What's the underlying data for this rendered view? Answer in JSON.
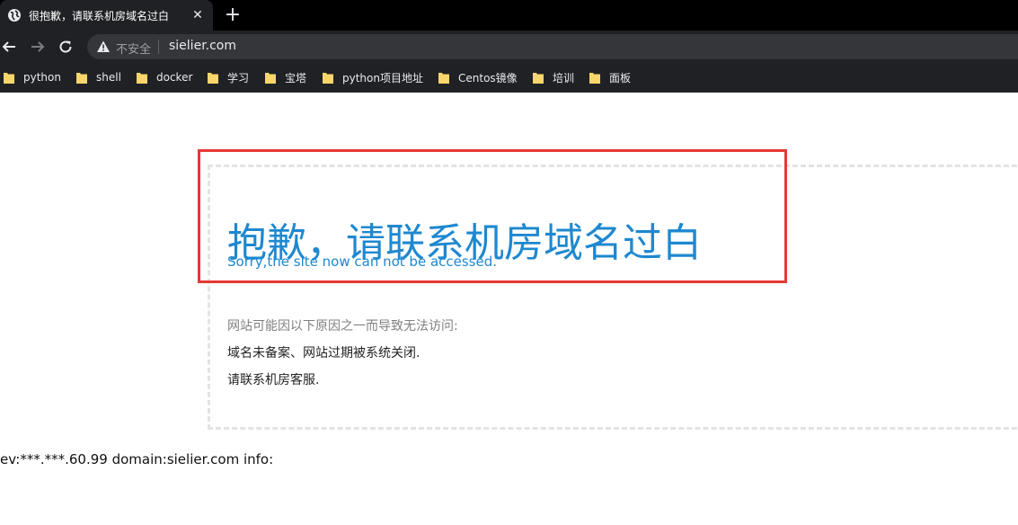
{
  "browser": {
    "tab": {
      "title": "很抱歉，请联系机房域名过白",
      "close": "✕"
    },
    "new_tab": "+",
    "address": {
      "security_label": "不安全",
      "url": "sielier.com"
    },
    "bookmarks": [
      {
        "label": "python"
      },
      {
        "label": "shell"
      },
      {
        "label": "docker"
      },
      {
        "label": "学习"
      },
      {
        "label": "宝塔"
      },
      {
        "label": "python项目地址"
      },
      {
        "label": "Centos镜像"
      },
      {
        "label": "培训"
      },
      {
        "label": "面板"
      }
    ]
  },
  "page": {
    "headline": "抱歉，请联系机房域名过白",
    "subline": "Sorry,the site now can not be accessed.",
    "reason_title": "网站可能因以下原因之一而导致无法访问:",
    "reasons": [
      "域名未备案、网站过期被系统关闭.",
      "请联系机房客服."
    ],
    "footer_info": "ev:***.***.60.99 domain:sielier.com info:"
  },
  "colors": {
    "accent_blue": "#1e88d0",
    "highlight_red": "#e53935",
    "chrome_dark": "#202124"
  }
}
